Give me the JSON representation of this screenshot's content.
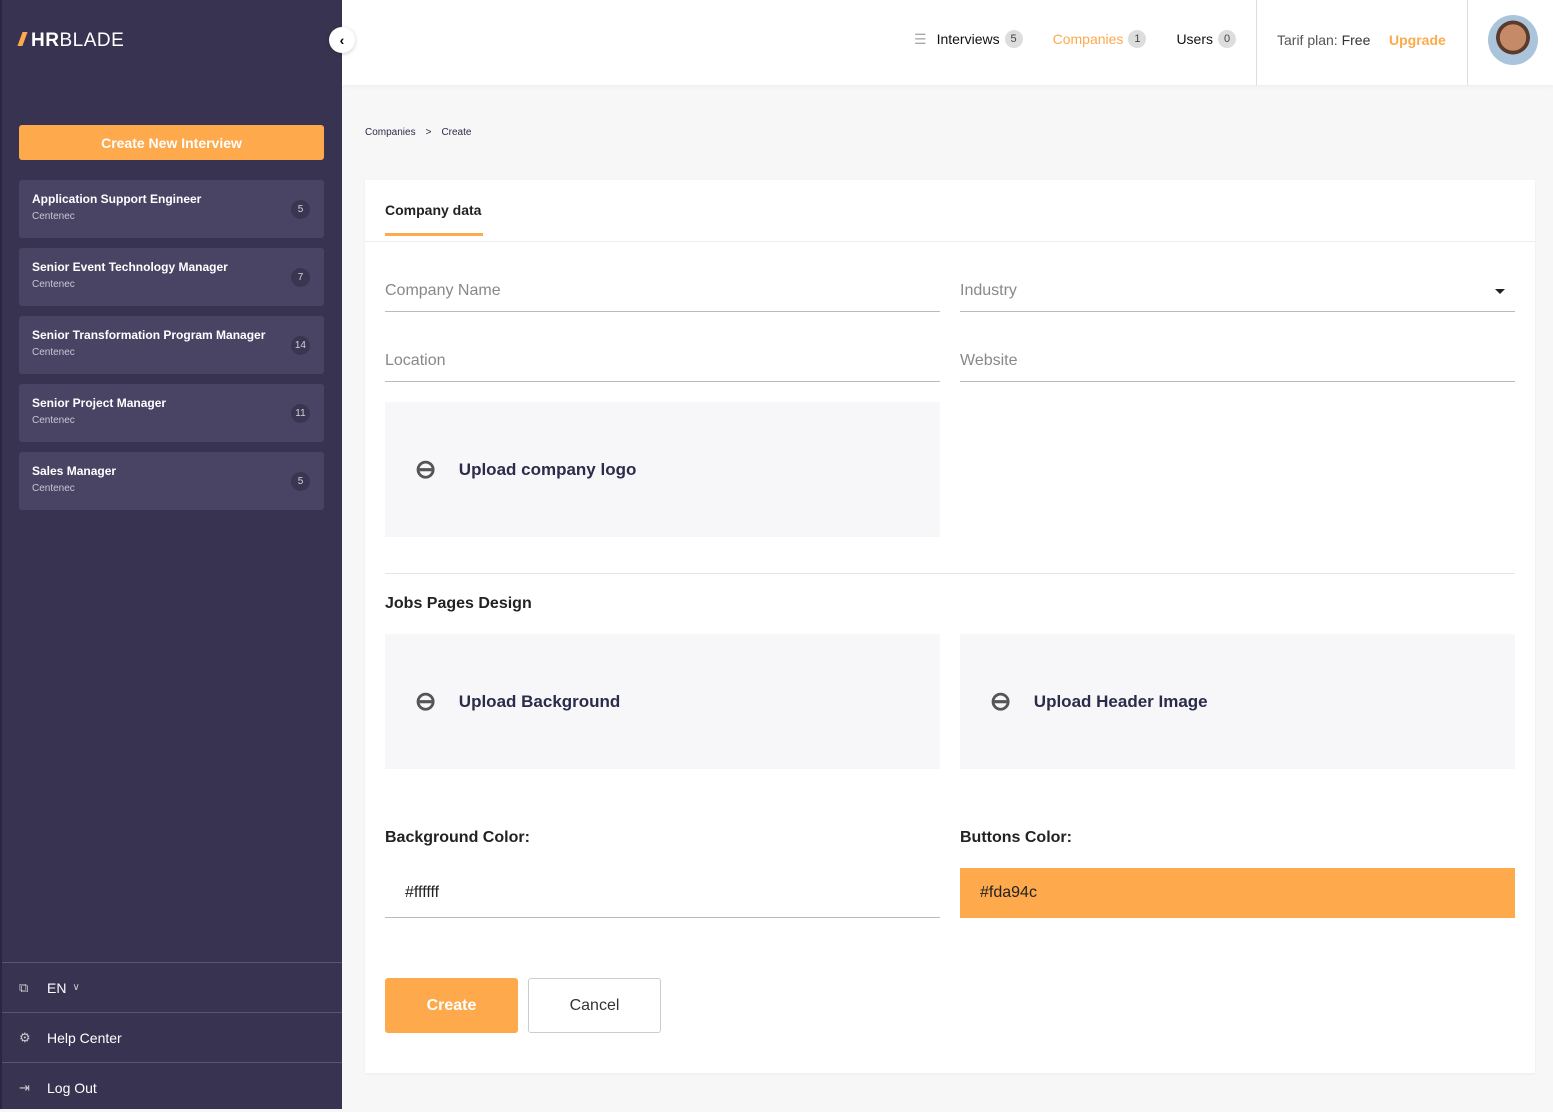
{
  "sidebar": {
    "logo_bold": "HR",
    "logo_light": "BLADE",
    "create_label": "Create New Interview",
    "jobs": [
      {
        "title": "Application Support Engineer",
        "company": "Centenec",
        "count": "5"
      },
      {
        "title": "Senior Event Technology Manager",
        "company": "Centenec",
        "count": "7"
      },
      {
        "title": "Senior Transformation Program Manager",
        "company": "Centenec",
        "count": "14"
      },
      {
        "title": "Senior Project Manager",
        "company": "Centenec",
        "count": "11"
      },
      {
        "title": "Sales Manager",
        "company": "Centenec",
        "count": "5"
      }
    ],
    "language": "EN",
    "help": "Help Center",
    "logout": "Log Out"
  },
  "topbar": {
    "nav": [
      {
        "label": "Interviews",
        "count": "5"
      },
      {
        "label": "Companies",
        "count": "1"
      },
      {
        "label": "Users",
        "count": "0"
      }
    ],
    "tarif_label": "Tarif plan:",
    "tarif_value": "Free",
    "upgrade": "Upgrade"
  },
  "breadcrumb": [
    "Companies",
    ">",
    "Create"
  ],
  "form": {
    "tab": "Company data",
    "company_name": "Company Name",
    "industry": "Industry",
    "location": "Location",
    "website": "Website",
    "upload_logo": "Upload company logo",
    "design_title": "Jobs Pages Design",
    "upload_bg": "Upload Background",
    "upload_header": "Upload Header Image",
    "bg_color_label": "Background Color:",
    "bg_color": "#ffffff",
    "btn_color_label": "Buttons Color:",
    "btn_color": "#fda94c",
    "create": "Create",
    "cancel": "Cancel"
  },
  "colors": {
    "accent": "#fda94c",
    "sidebar": "#393352"
  }
}
